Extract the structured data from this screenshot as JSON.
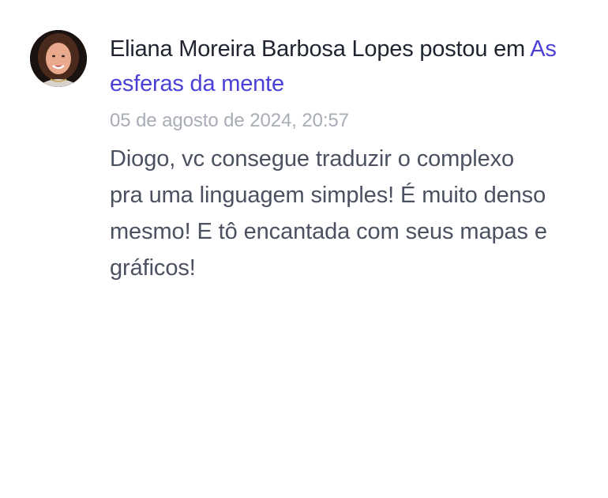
{
  "post": {
    "author_name": "Eliana Moreira Barbosa Lopes",
    "action_text": "postou em",
    "group_name": "As esferas da mente",
    "timestamp": "05 de agosto de 2024, 20:57",
    "message": "Diogo, vc consegue traduzir o complexo pra uma linguagem simples! É muito denso mesmo! E tô encantada com seus mapas e gráficos!",
    "avatar_icon": "user-avatar-photo",
    "colors": {
      "author": "#1f2430",
      "link": "#4a3fd6",
      "timestamp": "#a9adb6",
      "message": "#4b5160"
    }
  }
}
